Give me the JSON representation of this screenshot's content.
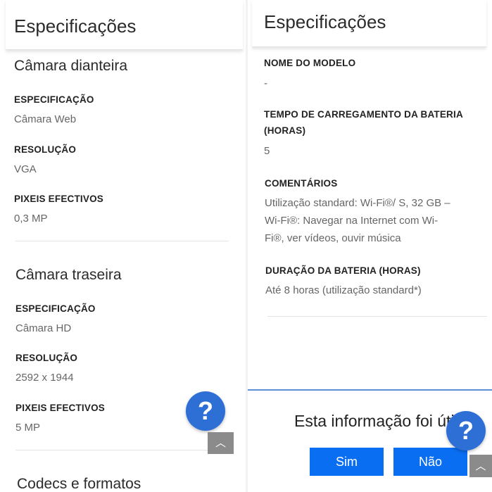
{
  "left": {
    "header_title": "Especificações",
    "front_camera": {
      "title": "Câmara dianteira",
      "spec_label": "ESPECIFICAÇÃO",
      "spec_value": "Câmara Web",
      "res_label": "RESOLUÇÃO",
      "res_value": "VGA",
      "px_label": "PIXEIS EFECTIVOS",
      "px_value": "0,3 MP"
    },
    "rear_camera": {
      "title": "Câmara traseira",
      "spec_label": "ESPECIFICAÇÃO",
      "spec_value": "Câmara HD",
      "res_label": "RESOLUÇÃO",
      "res_value": "2592 x 1944",
      "px_label": "PIXEIS EFECTIVOS",
      "px_value": "5 MP"
    },
    "codecs_title": "Codecs e formatos",
    "help_glyph": "?",
    "top_glyph": "︿"
  },
  "right": {
    "header_title": "Especificações",
    "model_label": "NOME DO MODELO",
    "model_value": "-",
    "charge_label_1": "TEMPO DE CARREGAMENTO DA BATERIA",
    "charge_label_2": "(HORAS)",
    "charge_value": "5",
    "comments_label": "COMENTÁRIOS",
    "comments_line_1": "Utilização standard: Wi-Fi®/ S, 32 GB –",
    "comments_line_2": "Wi-Fi®: Navegar na Internet com Wi-",
    "comments_line_3": "Fi®, ver vídeos, ouvir música",
    "battery_label": "DURAÇÃO DA BATERIA (HORAS)",
    "battery_value": "Até 8 horas (utilização standard*)",
    "feedback_question": "Esta informação foi útil?",
    "yes_label": "Sim",
    "no_label": "Não",
    "help_glyph": "?",
    "top_glyph": "︿"
  },
  "colors": {
    "help_button": "#2e6fd6",
    "feedback_button": "#0a6ef2",
    "scroll_top_button": "#8b8b8b"
  },
  "icons": [
    "help-icon",
    "chevron-up-icon"
  ]
}
